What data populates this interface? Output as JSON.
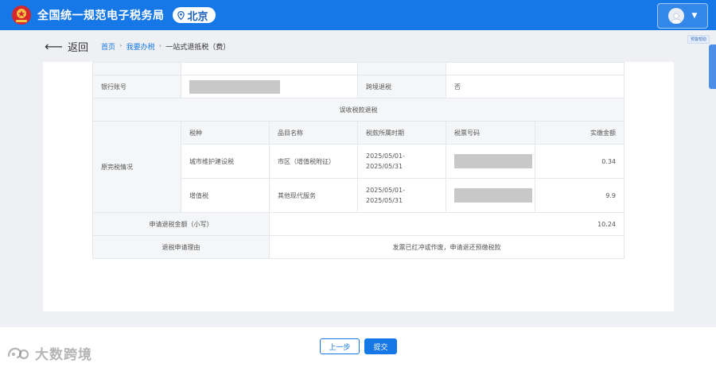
{
  "header": {
    "app_title": "全国统一规范电子税务局",
    "region": "北京"
  },
  "nav": {
    "back_label": "返回",
    "breadcrumb": [
      "首页",
      "我要办税",
      "一站式退抵税（费）"
    ]
  },
  "side": {
    "tag": "预警帮助"
  },
  "form": {
    "bank_account_label": "银行账号",
    "cross_region_label": "跨境退税",
    "cross_region_value": "否",
    "section_title": "误收税款退税",
    "original_tax_label": "原完税情况",
    "columns": [
      "税种",
      "品目名称",
      "税款所属时期",
      "税票号码",
      "实缴金额"
    ],
    "rows": [
      {
        "tax_type": "城市维护建设税",
        "item": "市区（增值税附征）",
        "period_start": "2025/05/01-",
        "period_end": "2025/05/31",
        "amount": "0.34"
      },
      {
        "tax_type": "增值税",
        "item": "其他现代服务",
        "period_start": "2025/05/01-",
        "period_end": "2025/05/31",
        "amount": "9.9"
      }
    ],
    "refund_amount_label": "申请退税金额（小写）",
    "refund_amount_value": "10.24",
    "reason_label": "退税申请理由",
    "reason_value": "发票已红冲或作废，申请退还预缴税款"
  },
  "footer": {
    "prev_label": "上一步",
    "submit_label": "提交",
    "watermark": "大数跨境"
  },
  "colors": {
    "brand": "#1677e6",
    "page_bg": "#eef0f3"
  }
}
